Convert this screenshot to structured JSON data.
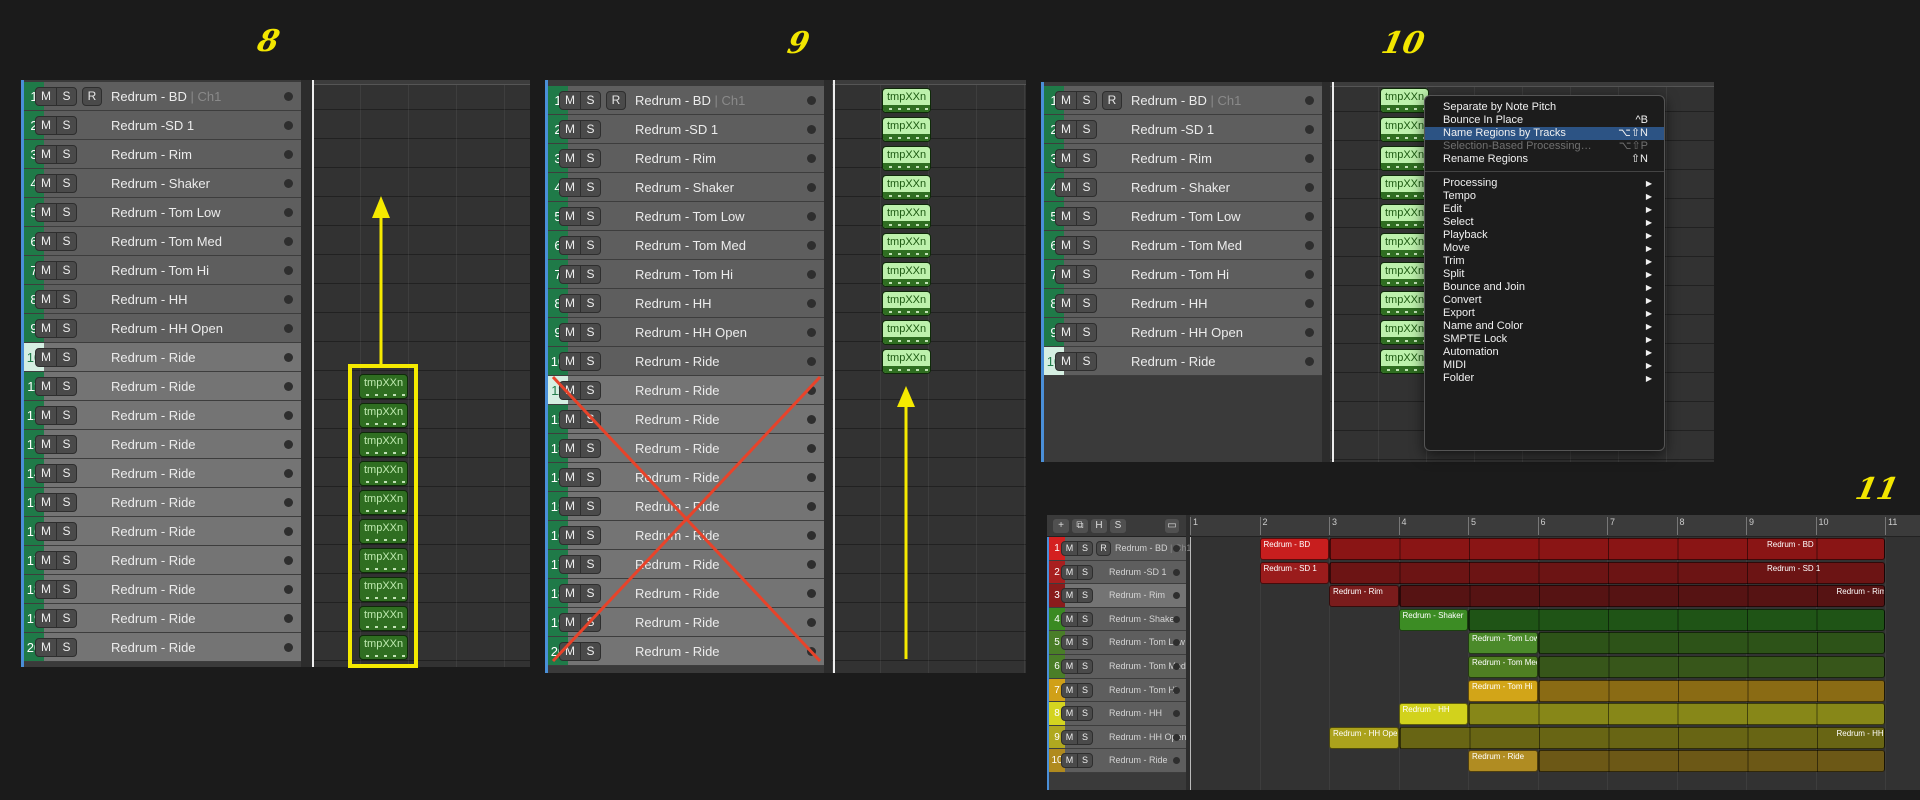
{
  "steps": {
    "s8": "8",
    "s9": "9",
    "s10": "10",
    "s11": "11"
  },
  "buttons": {
    "mute": "M",
    "solo": "S",
    "record": "R"
  },
  "region_label": "tmpXXn",
  "channel": "Ch1",
  "panel8": {
    "track_names": [
      "Redrum - BD",
      "Redrum -SD 1",
      "Redrum - Rim",
      "Redrum - Shaker",
      "Redrum - Tom Low",
      "Redrum - Tom Med",
      "Redrum - Tom Hi",
      "Redrum - HH",
      "Redrum - HH Open",
      "Redrum - Ride",
      "Redrum - Ride",
      "Redrum - Ride",
      "Redrum - Ride",
      "Redrum - Ride",
      "Redrum - Ride",
      "Redrum - Ride",
      "Redrum - Ride",
      "Redrum - Ride",
      "Redrum - Ride",
      "Redrum - Ride"
    ],
    "current_track": 10,
    "regions_on_tracks": [
      11,
      12,
      13,
      14,
      15,
      16,
      17,
      18,
      19,
      20
    ]
  },
  "panel9": {
    "track_names": [
      "Redrum - BD",
      "Redrum -SD 1",
      "Redrum - Rim",
      "Redrum - Shaker",
      "Redrum - Tom Low",
      "Redrum - Tom Med",
      "Redrum - Tom Hi",
      "Redrum - HH",
      "Redrum - HH Open",
      "Redrum - Ride",
      "Redrum - Ride",
      "Redrum - Ride",
      "Redrum - Ride",
      "Redrum - Ride",
      "Redrum - Ride",
      "Redrum - Ride",
      "Redrum - Ride",
      "Redrum - Ride",
      "Redrum - Ride",
      "Redrum - Ride"
    ],
    "current_track": 11,
    "regions_on_tracks": [
      1,
      2,
      3,
      4,
      5,
      6,
      7,
      8,
      9,
      10
    ]
  },
  "panel10": {
    "track_names": [
      "Redrum - BD",
      "Redrum -SD 1",
      "Redrum - Rim",
      "Redrum - Shaker",
      "Redrum - Tom Low",
      "Redrum - Tom Med",
      "Redrum - Tom Hi",
      "Redrum - HH",
      "Redrum - HH Open",
      "Redrum - Ride"
    ],
    "current_track": 10,
    "context_menu": {
      "top": [
        {
          "label": "Separate by Note Pitch",
          "shortcut": ""
        },
        {
          "label": "Bounce In Place",
          "shortcut": "^B"
        },
        {
          "label": "Name Regions by Tracks",
          "shortcut": "⌥⇧N",
          "highlighted": true
        },
        {
          "label": "Selection-Based Processing…",
          "shortcut": "⌥⇧P",
          "disabled": true
        },
        {
          "label": "Rename Regions",
          "shortcut": "⇧N"
        }
      ],
      "submenus": [
        "Processing",
        "Tempo",
        "Edit",
        "Select",
        "Playback",
        "Move",
        "Trim",
        "Split",
        "Bounce and Join",
        "Convert",
        "Export",
        "Name and Color",
        "SMPTE Lock",
        "Automation",
        "MIDI",
        "Folder"
      ]
    }
  },
  "panel11": {
    "toolbar": {
      "add": "+",
      "hide": "H",
      "solo": "S"
    },
    "bars": [
      "1",
      "2",
      "3",
      "4",
      "5",
      "6",
      "7",
      "8",
      "9",
      "10",
      "11"
    ],
    "tracks": [
      {
        "name": "Redrum - BD",
        "color": "#d42020",
        "region": "Redrum - BD",
        "start": 2,
        "end": 11,
        "bright": "#c81e1e",
        "loop": "#8a1515",
        "loop_label": "Redrum - BD",
        "loop_label_bar": 9
      },
      {
        "name": "Redrum -SD 1",
        "color": "#a81f1f",
        "region": "Redrum - SD 1",
        "start": 2,
        "end": 11,
        "bright": "#9a1c1c",
        "loop": "#6c1414",
        "loop_label": "Redrum - SD 1",
        "loop_label_bar": 9
      },
      {
        "name": "Redrum - Rim",
        "color": "#8a1c1c",
        "region": "Redrum - Rim",
        "start": 3,
        "end": 11,
        "bright": "#7a1c1c",
        "loop": "#561313",
        "loop_label": "Redrum - Rim",
        "loop_label_bar": 10
      },
      {
        "name": "Redrum - Shaker",
        "color": "#3a8a22",
        "region": "Redrum - Shaker",
        "start": 4,
        "end": 11,
        "bright": "#3c8c24",
        "loop": "#1f5416"
      },
      {
        "name": "Redrum - Tom Low",
        "color": "#4a7e28",
        "region": "Redrum - Tom Low",
        "start": 5,
        "end": 11,
        "bright": "#4b8a2a",
        "loop": "#2d5318"
      },
      {
        "name": "Redrum - Tom Med",
        "color": "#4a7e28",
        "region": "Redrum - Tom Med",
        "start": 5,
        "end": 11,
        "bright": "#4f7f22",
        "loop": "#37561a"
      },
      {
        "name": "Redrum - Tom Hi",
        "color": "#d0a018",
        "region": "Redrum - Tom Hi",
        "start": 5,
        "end": 11,
        "bright": "#d2a518",
        "loop": "#8a6b14"
      },
      {
        "name": "Redrum - HH",
        "color": "#d4d420",
        "region": "Redrum - HH",
        "start": 4,
        "end": 11,
        "bright": "#d2d21c",
        "loop": "#878718"
      },
      {
        "name": "Redrum - HH Open",
        "color": "#b0a820",
        "region": "Redrum - HH Open",
        "start": 3,
        "end": 11,
        "bright": "#aba21c",
        "loop": "#686514",
        "loop_label": "Redrum - HH Op",
        "loop_label_bar": 10
      },
      {
        "name": "Redrum - Ride",
        "color": "#b08a1e",
        "region": "Redrum - Ride",
        "start": 5,
        "end": 11,
        "bright": "#b08c22",
        "loop": "#6c5816"
      }
    ],
    "current_track": 3
  },
  "colors": {
    "annotation_yellow": "#f5ea00",
    "cross_red": "#e8432a",
    "track_green": "#1f7a48",
    "menu_highlight": "#2c5384"
  }
}
